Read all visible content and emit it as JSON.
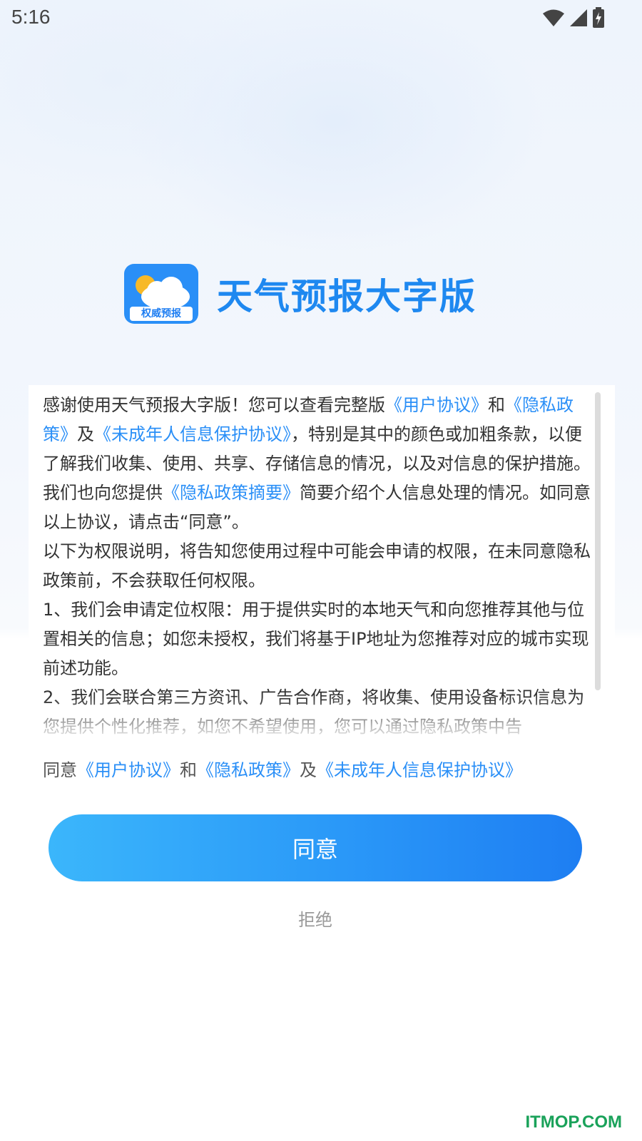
{
  "status_bar": {
    "time": "5:16"
  },
  "app": {
    "name": "天气预报大字版",
    "icon_badge": "权威预报"
  },
  "agreement": {
    "paragraphs": [
      [
        {
          "text": "感谢使用天气预报大字版！您可以查看完整版"
        },
        {
          "text": "《用户协议》",
          "link": true
        },
        {
          "text": "和"
        },
        {
          "text": "《隐私政策》",
          "link": true
        },
        {
          "text": "及"
        },
        {
          "text": "《未成年人信息保护协议》",
          "link": true
        },
        {
          "text": "，特别是其中的颜色或加粗条款，以便了解我们收集、使用、共享、存储信息的情况，以及对信息的保护措施。我们也向您提供"
        },
        {
          "text": "《隐私政策摘要》",
          "link": true
        },
        {
          "text": "简要介绍个人信息处理的情况。如同意以上协议，请点击“同意”。"
        }
      ],
      [
        {
          "text": "以下为权限说明，将告知您使用过程中可能会申请的权限，在未同意隐私政策前，不会获取任何权限。"
        }
      ],
      [
        {
          "text": "1、我们会申请定位权限：用于提供实时的本地天气和向您推荐其他与位置相关的信息；如您未授权，我们将基于IP地址为您推荐对应的城市实现前述功能。"
        }
      ],
      [
        {
          "text": "2、我们会联合第三方资讯、广告合作商，将收集、使用设备标识信息为您提供个性化推荐，如您不希望使用，您可以通过隐私政策中告"
        }
      ]
    ],
    "consent_parts": {
      "p1": "同意",
      "user_agreement": "《用户协议》",
      "p2": "和",
      "privacy_policy": "《隐私政策》",
      "p3": "及",
      "minor_protection": "《未成年人信息保护协议》"
    }
  },
  "buttons": {
    "agree": "同意",
    "reject": "拒绝"
  },
  "watermark": "ITMOP.COM",
  "colors": {
    "link": "#2a8ff7",
    "brand": "#1e88f0",
    "button_start": "#3bb6fb",
    "button_end": "#1e7ef2",
    "watermark": "#1aa25a"
  }
}
